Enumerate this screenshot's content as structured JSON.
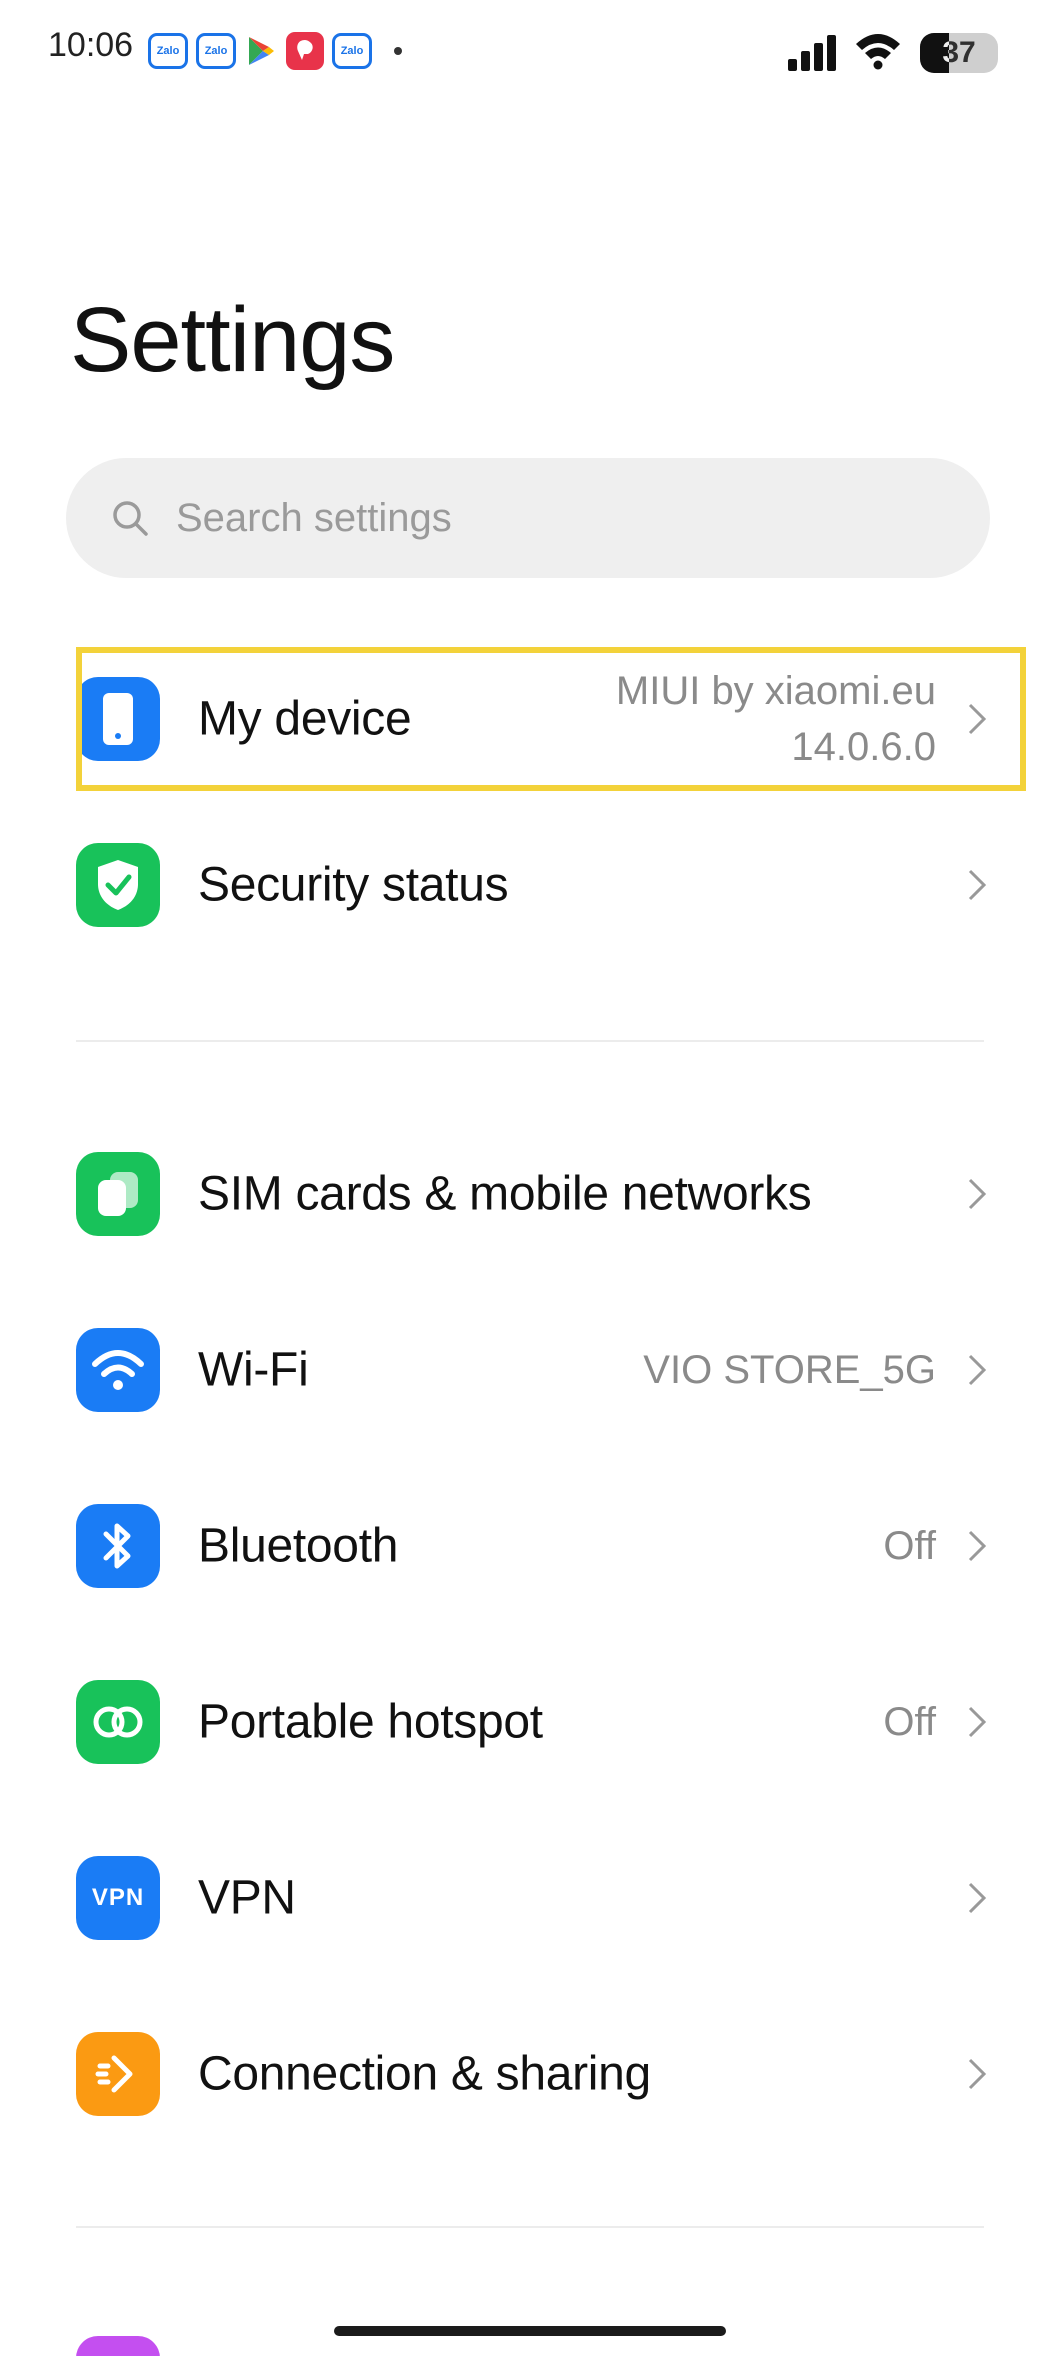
{
  "status_bar": {
    "time": "10:06",
    "notification_icons": [
      "zalo-icon",
      "zalo-icon",
      "play-store-icon",
      "red-app-icon",
      "zalo-icon"
    ],
    "zalo_label": "Zalo",
    "battery": "37",
    "battery_level": 0.37
  },
  "page": {
    "title": "Settings"
  },
  "search": {
    "placeholder": "Search settings",
    "value": ""
  },
  "items": [
    {
      "label": "My device",
      "value": "MIUI by xiaomi.eu\n14.0.6.0",
      "icon": "phone-icon",
      "color": "#1a7cf5"
    },
    {
      "label": "Security status",
      "value": "",
      "icon": "shield-check-icon",
      "color": "#18c25a"
    },
    {
      "label": "SIM cards & mobile networks",
      "value": "",
      "icon": "sim-card-icon",
      "color": "#18c25a"
    },
    {
      "label": "Wi-Fi",
      "value": "VIO STORE_5G",
      "icon": "wifi-icon",
      "color": "#1a7cf5"
    },
    {
      "label": "Bluetooth",
      "value": "Off",
      "icon": "bluetooth-icon",
      "color": "#1a7cf5"
    },
    {
      "label": "Portable hotspot",
      "value": "Off",
      "icon": "hotspot-icon",
      "color": "#18c25a"
    },
    {
      "label": "VPN",
      "value": "",
      "icon": "vpn-icon",
      "icon_text": "VPN",
      "color": "#1a7cf5"
    },
    {
      "label": "Connection & sharing",
      "value": "",
      "icon": "connection-sharing-icon",
      "color": "#fb9a12"
    }
  ],
  "colors": {
    "highlight": "#f3d23a",
    "blue": "#1a7cf5",
    "green": "#18c25a",
    "orange": "#fb9a12",
    "purple": "#c44ff0"
  }
}
